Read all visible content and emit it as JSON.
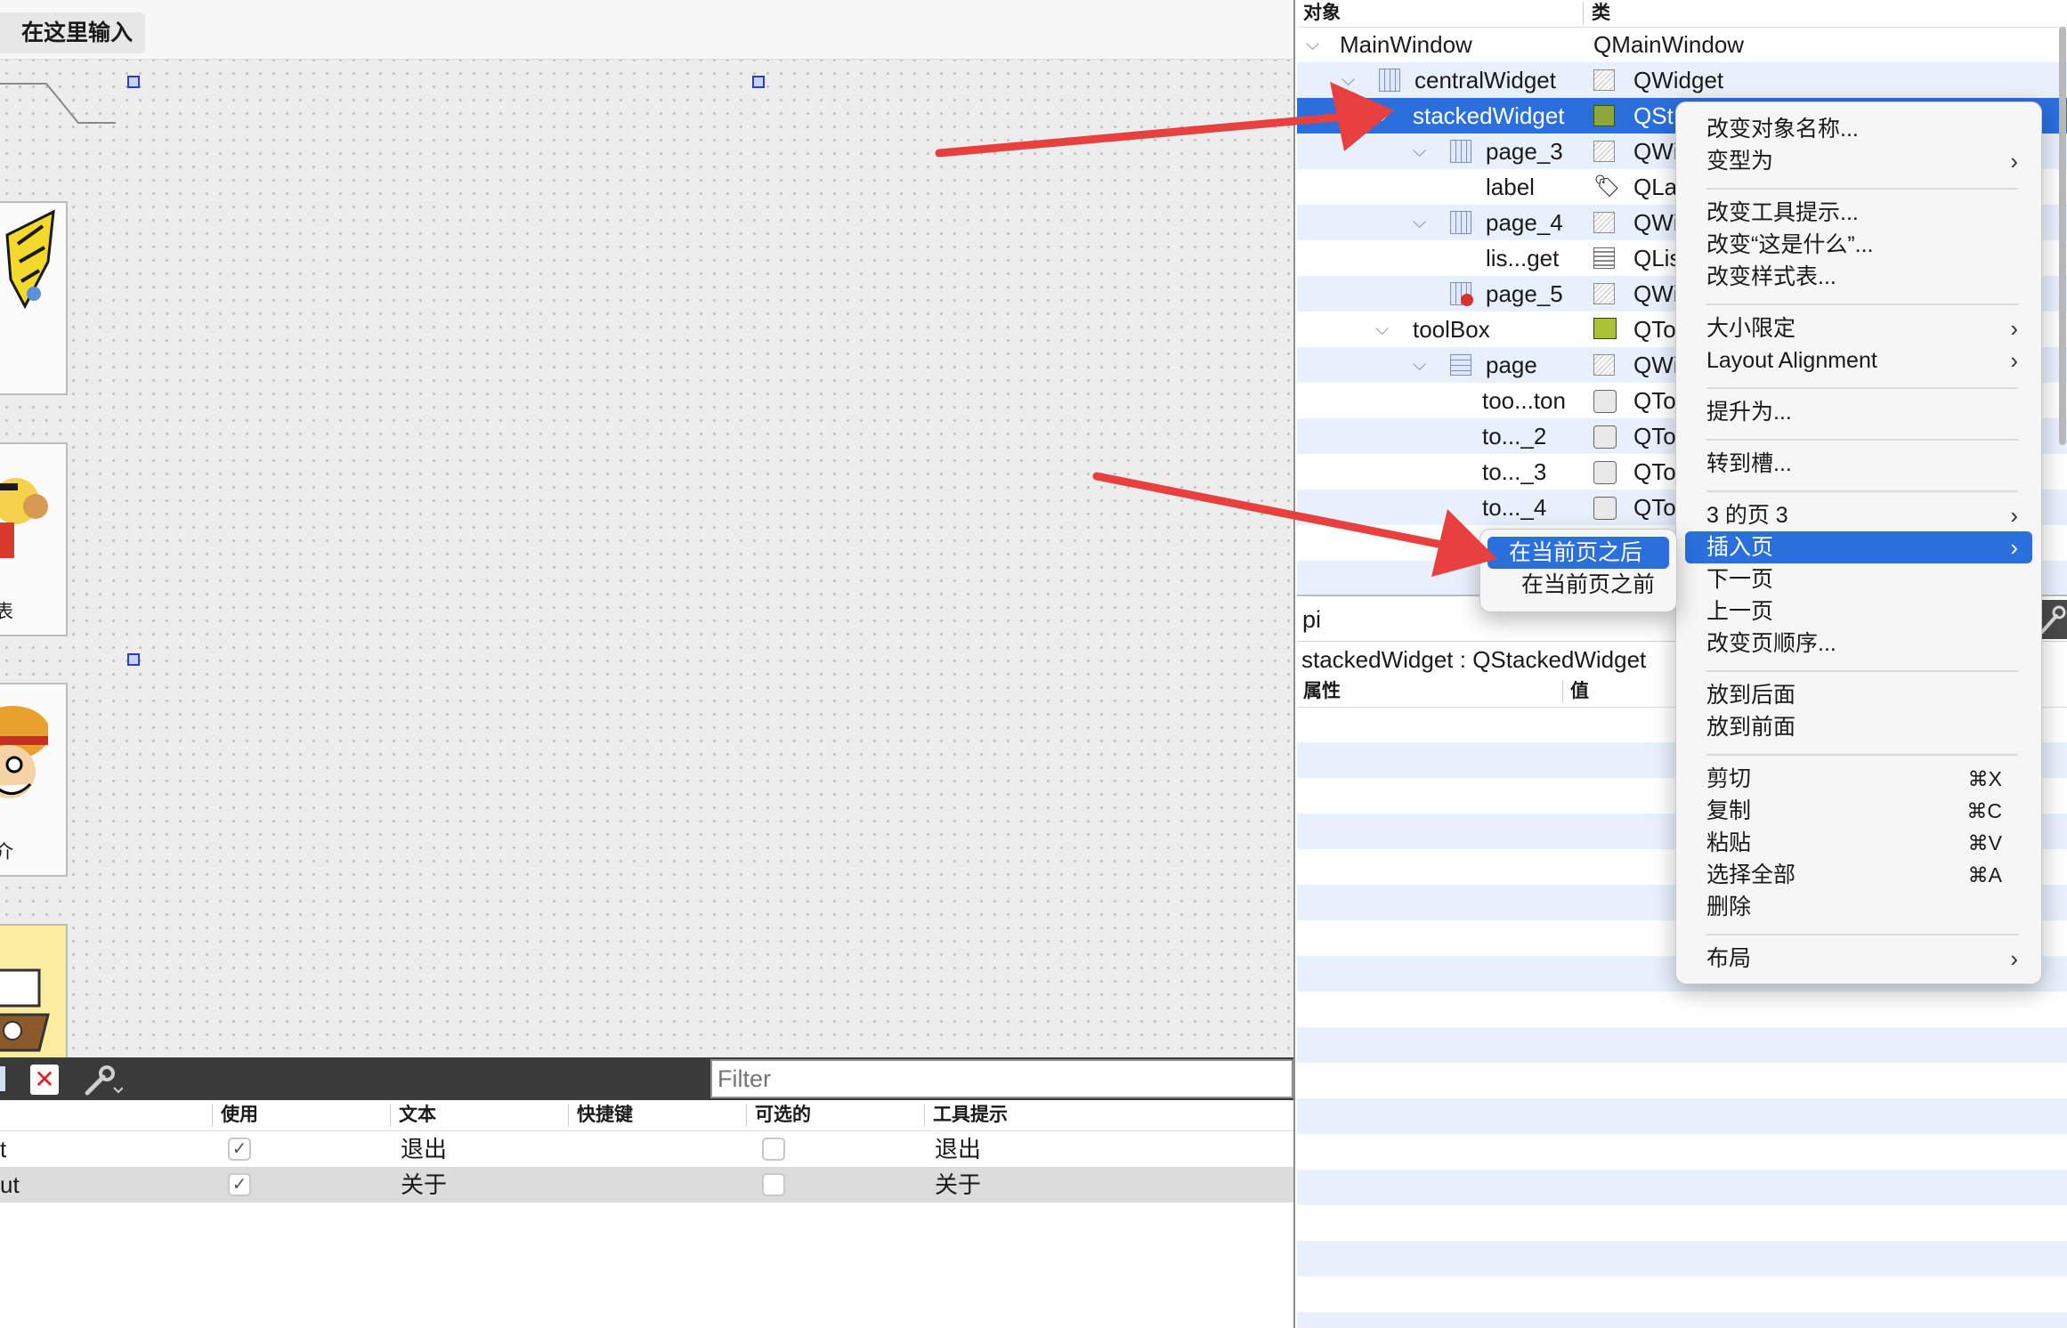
{
  "form_editor": {
    "menubar_placeholder": "在这里输入",
    "tool_labels": [
      "!",
      "表",
      "介"
    ]
  },
  "action_editor": {
    "filter_placeholder": "Filter",
    "columns": [
      "使用",
      "文本",
      "快捷键",
      "可选的",
      "工具提示"
    ],
    "rows": [
      {
        "name": "t",
        "used": "✓",
        "text": "退出",
        "shortcut": "",
        "checkable": "",
        "tooltip": "退出"
      },
      {
        "name": "ut",
        "used": "✓",
        "text": "关于",
        "shortcut": "",
        "checkable": "",
        "tooltip": "关于"
      }
    ]
  },
  "object_inspector": {
    "headers": [
      "对象",
      "类"
    ],
    "tree": [
      {
        "name": "MainWindow",
        "class": "QMainWindow"
      },
      {
        "name": "centralWidget",
        "class": "QWidget"
      },
      {
        "name": "stackedWidget",
        "class": "QSt"
      },
      {
        "name": "page_3",
        "class": "QWi"
      },
      {
        "name": "label",
        "class": "QLa"
      },
      {
        "name": "page_4",
        "class": "QWi"
      },
      {
        "name": "lis...get",
        "class": "QLis"
      },
      {
        "name": "page_5",
        "class": "QWi"
      },
      {
        "name": "toolBox",
        "class": "QTo"
      },
      {
        "name": "page",
        "class": "QWi"
      },
      {
        "name": "too...ton",
        "class": "QTo"
      },
      {
        "name": "to..._2",
        "class": "QTo"
      },
      {
        "name": "to..._3",
        "class": "QTo"
      },
      {
        "name": "to..._4",
        "class": "QTo"
      }
    ]
  },
  "property_editor": {
    "filter_value": "pi",
    "object_label": "stackedWidget : QStackedWidget",
    "headers": [
      "属性",
      "值"
    ]
  },
  "context_menu": {
    "items": {
      "rename": "改变对象名称...",
      "morph": "变型为",
      "tooltip": "改变工具提示...",
      "whatsthis": "改变“这是什么”...",
      "stylesheet": "改变样式表...",
      "size_constraints": "大小限定",
      "layout_alignment": "Layout Alignment",
      "promote": "提升为...",
      "goto_slot": "转到槽...",
      "page_of": "3 的页 3",
      "insert_page": "插入页",
      "next_page": "下一页",
      "prev_page": "上一页",
      "reorder": "改变页顺序...",
      "send_back": "放到后面",
      "bring_front": "放到前面",
      "cut": "剪切",
      "copy": "复制",
      "paste": "粘贴",
      "select_all": "选择全部",
      "delete": "删除",
      "layout": "布局"
    },
    "shortcuts": {
      "cut": "⌘X",
      "copy": "⌘C",
      "paste": "⌘V",
      "select_all": "⌘A"
    }
  },
  "submenu": {
    "after": "在当前页之后",
    "before": "在当前页之前"
  },
  "colors": {
    "selection": "#2a6fdc",
    "arrow": "#e8403f"
  }
}
